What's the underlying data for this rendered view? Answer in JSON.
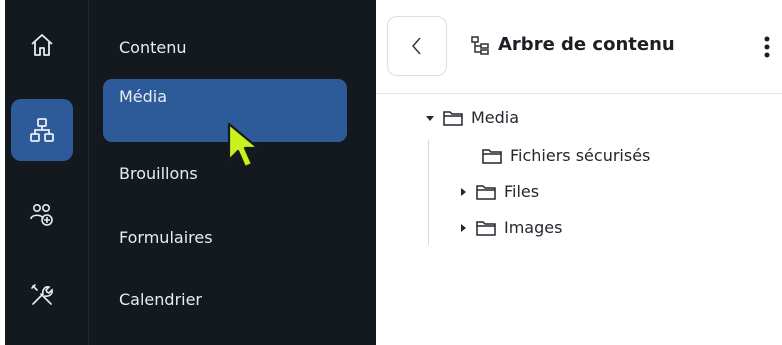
{
  "rail": {
    "items": [
      {
        "icon": "home-icon"
      },
      {
        "icon": "sitemap-icon",
        "active": true
      },
      {
        "icon": "users-add-icon"
      },
      {
        "icon": "tools-icon"
      }
    ]
  },
  "subnav": {
    "items": [
      {
        "label": "Contenu"
      },
      {
        "label": "Média",
        "active": true
      },
      {
        "label": "Brouillons"
      },
      {
        "label": "Formulaires"
      },
      {
        "label": "Calendrier"
      }
    ]
  },
  "panel": {
    "title": "Arbre de contenu",
    "tree": [
      {
        "label": "Media",
        "expanded": true
      },
      {
        "label": "Fichiers sécurisés"
      },
      {
        "label": "Files"
      },
      {
        "label": "Images"
      }
    ]
  },
  "colors": {
    "sidebar_bg": "#14191f",
    "active_bg": "#2d5a99",
    "cursor": "#c6f21e"
  }
}
